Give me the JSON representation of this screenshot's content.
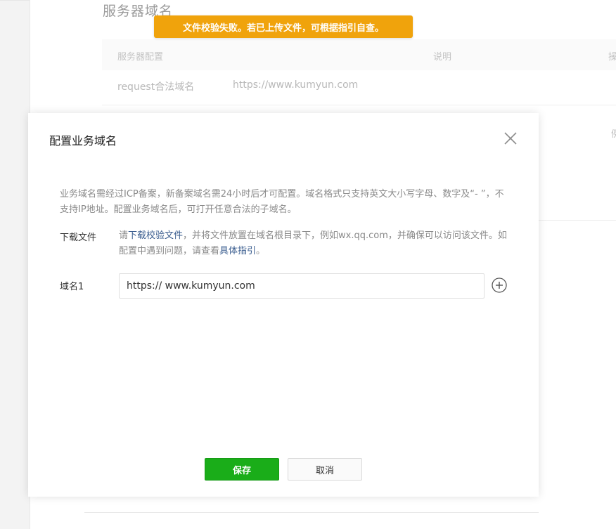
{
  "background": {
    "section_title": "服务器域名",
    "table": {
      "headers": [
        "服务器配置",
        "说明",
        "操"
      ],
      "row": {
        "name": "request合法域名",
        "value": "https://www.kumyun.com"
      }
    },
    "edge_mark": "例"
  },
  "toast": {
    "message": "文件校验失败。若已上传文件，可根据指引自查。",
    "color": "#f0a30c"
  },
  "dialog": {
    "title": "配置业务域名",
    "description": "业务域名需经过ICP备案，新备案域名需24小时后才可配置。域名格式只支持英文大小写字母、数字及“- ”，不支持IP地址。配置业务域名后，可打开任意合法的子域名。",
    "download": {
      "label": "下载文件",
      "text_prefix": "请",
      "link_download": "下载校验文件",
      "text_middle": "，并将文件放置在域名根目录下，例如wx.qq.com，并确保可以访问该文件。如配置中遇到问题，请查看",
      "link_guide": "具体指引",
      "text_suffix": "。"
    },
    "domain": {
      "label": "域名1",
      "value": "https:// www.kumyun.com",
      "add_icon": "plus-circle-icon"
    },
    "close_icon": "close-icon",
    "buttons": {
      "save": "保存",
      "cancel": "取消"
    },
    "save_color": "#1aad19"
  }
}
